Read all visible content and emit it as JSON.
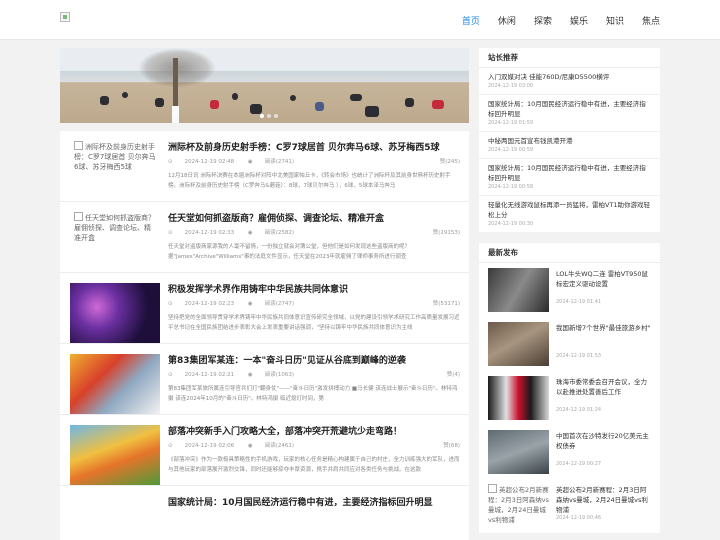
{
  "header": {
    "nav": [
      "首页",
      "休闲",
      "探索",
      "娱乐",
      "知识",
      "焦点"
    ],
    "active_index": 0,
    "accent_color": "#1e88e5"
  },
  "hero": {
    "slide_count": 3,
    "active_slide": 0
  },
  "articles": [
    {
      "title": "洲际杯及前身历史射手榜：C罗7球居首 贝尔奔马6球、苏牙梅西5球",
      "thumb_alt": "洲际杯及前身历史射手榜：C罗7球居首 贝尔奔马6球、苏牙梅西5球",
      "date": "2024-12-19 02:48",
      "reads": "阅读(2741)",
      "likes": "赞(245)",
      "summary": "12月18日讯 洲际杯决赛在本届洲际杯对阵中北美国家帕丘卡，《转会市场》也统计了洲际杯及其前身世俱杯历史射手榜。洲际杯及前身历史射手榜（C罗奔马&蘑菇）：8球，7球贝尔奔马 ），6球，5球本泽马奔马"
    },
    {
      "title": "任天堂如何抓盗版商？雇佣侦探、调查论坛、精准开盒",
      "thumb_alt": "任天堂如何抓盗版商？雇佣侦探、调查论坛、精准开盒",
      "date": "2024-12-19 02:33",
      "reads": "阅读(2582)",
      "likes": "赞(19153)",
      "summary": "任天堂对盗版商家源我的人毫不留情，一份独立就会对簿公堂，但他们是如何发现这些盗版商的呢？据\"James\"Archive\"Williams\"事的法庭文件显示，任天堂在2023年就雇佣了律师事务所进行调查"
    },
    {
      "title": "积极发挥学术界作用铸牢中华民族共同体意识",
      "thumb_alt": "",
      "date": "2024-12-19 02:23",
      "reads": "阅读(2747)",
      "likes": "赞(53171)",
      "summary": "坚持把党的全面领导贯穿学术界铸牢中华民族共同体意识宣传研究全领域，以党的建设引领学术研究工作高质量发展习近平总书记在全国民族团结进步表彰大会上发表重要讲话强调，\"坚持以铸牢中华民族共同体意识为主线"
    },
    {
      "title": "第83集团军某连：一本\"奋斗日历\"见证从谷底到巅峰的逆袭",
      "thumb_alt": "",
      "date": "2024-12-19 02:21",
      "reads": "阅读(1063)",
      "likes": "赞(4)",
      "summary": "第83集团军某旅所属连引导官兵们打\"翻身仗\"——\"奋斗日历\"激发拼搏动力 ■马长健 该连战士展示\"奋斗日历\"。林特鸿摄 该连2024年10月的\"奋斗日历\"。林特鸿摄 临近熄灯时间，第"
    },
    {
      "title": "部落冲突新手入门攻略大全，部落冲突开荒避坑少走弯路！",
      "thumb_alt": "",
      "date": "2024-12-19 02:06",
      "reads": "阅读(2461)",
      "likes": "赞(68)",
      "summary": "《部落冲突》作为一款极具策略性的手机游戏，玩家的核心任务是精心构建属于自己的村庄，全力训练强大的军队，进而与其他玩家的部落展开激烈交锋，同时还能够掠夺丰厚资源，携手并肩共同应对各类任务与挑战。在这款"
    },
    {
      "title": "国家统计局：10月国民经济运行稳中有进，主要经济指标回升明显",
      "thumb_alt": "",
      "date": "",
      "reads": "",
      "likes": "",
      "summary": ""
    }
  ],
  "sidebar": {
    "recommend_title": "站长推荐",
    "recommend": [
      {
        "title": "入门双媒对决 佳能760D/尼康D5500横评",
        "date": "2024-12-19 03:00"
      },
      {
        "title": "国家统计局：10月国民经济运行稳中有进，主要经济指标回升明显",
        "date": "2024-12-19 01:59"
      },
      {
        "title": "中秘两国元首宣布钱凯港开港",
        "date": "2024-12-19 00:59"
      },
      {
        "title": "国家统计局：10月国民经济运行稳中有进，主要经济指标回升明显",
        "date": "2024-12-19 00:58"
      },
      {
        "title": "轻量化无线游戏鼠标再添一员猛将，雷柏VT1助你游戏轻松上分",
        "date": "2024-12-19 00:30"
      }
    ],
    "latest_title": "最新发布",
    "latest": [
      {
        "title": "LOL牛头WQ二连 雷柏VT950鼠标宏定义驱动设置",
        "date": "2024-12-19 01:41"
      },
      {
        "title": "我国新增7个世界\"最佳旅游乡村\"",
        "date": "2024-12-19 01:53"
      },
      {
        "title": "珠海市委常委会召开会议，全力以赴推进处置善后工作",
        "date": "2024-12-19 01:24"
      },
      {
        "title": "中国首次在沙特发行20亿美元主权债券",
        "date": "2024-12-19 00:27"
      },
      {
        "title": "英超公布2月新赛程：2月3日阿森纳vs曼城，2月24日曼城vs利物浦",
        "date": "2024-12-19 00:46"
      }
    ],
    "latest5_thumb_alt": "英超公布2月新赛程：2月3日阿森纳vs曼城，2月24日曼城vs利物浦"
  }
}
